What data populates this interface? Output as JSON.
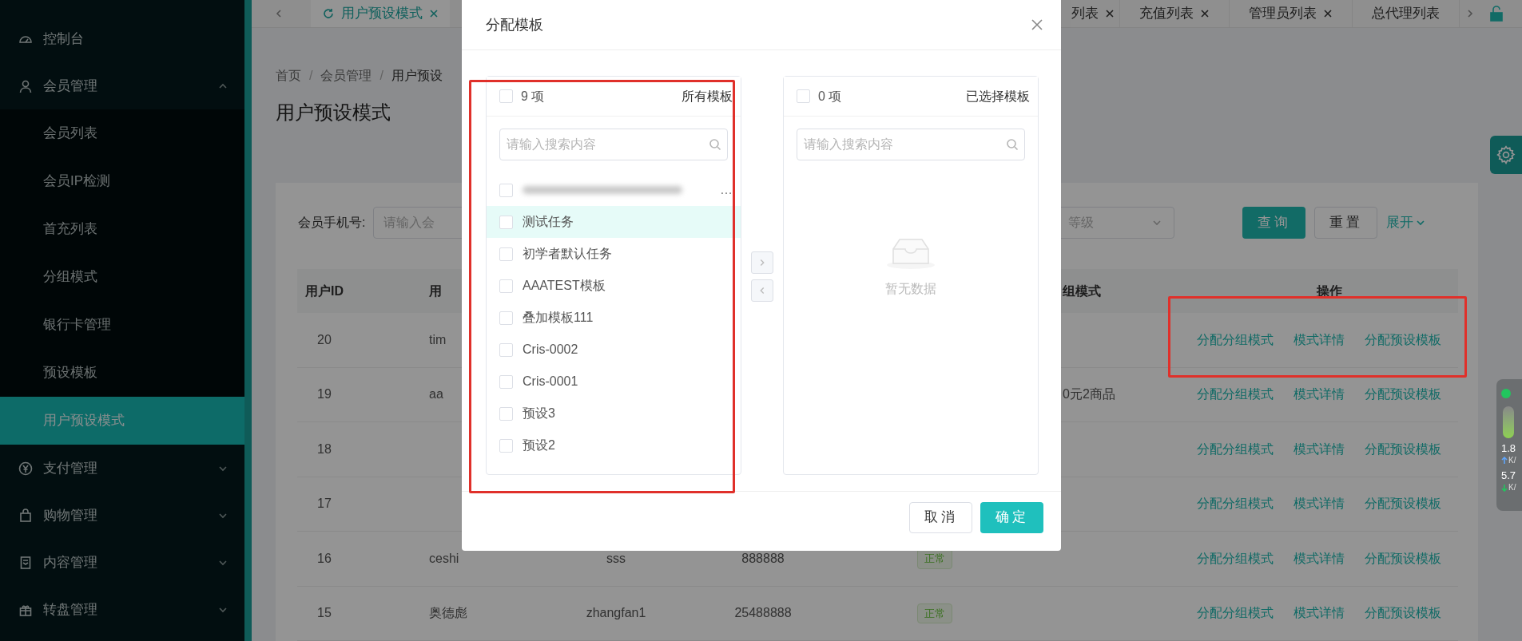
{
  "sidebar": {
    "items": [
      {
        "label": "控制台",
        "kind": "link",
        "selected": false
      },
      {
        "label": "会员管理",
        "kind": "group",
        "expanded": true,
        "children": [
          {
            "label": "会员列表",
            "selected": false
          },
          {
            "label": "会员IP检测",
            "selected": false
          },
          {
            "label": "首充列表",
            "selected": false
          },
          {
            "label": "分组模式",
            "selected": false
          },
          {
            "label": "银行卡管理",
            "selected": false
          },
          {
            "label": "预设模板",
            "selected": false
          },
          {
            "label": "用户预设模式",
            "selected": true
          }
        ]
      },
      {
        "label": "支付管理",
        "kind": "group",
        "expanded": false
      },
      {
        "label": "购物管理",
        "kind": "group",
        "expanded": false
      },
      {
        "label": "内容管理",
        "kind": "group",
        "expanded": false
      },
      {
        "label": "转盘管理",
        "kind": "group",
        "expanded": false
      }
    ]
  },
  "tabs": [
    {
      "label": "用户预设模式",
      "selected": true,
      "closable": true
    },
    {
      "label": "列表",
      "selected": false,
      "closable": true
    },
    {
      "label": "充值列表",
      "selected": false,
      "closable": true
    },
    {
      "label": "管理员列表",
      "selected": false,
      "closable": true
    },
    {
      "label": "总代理列表",
      "selected": false,
      "closable": false
    }
  ],
  "breadcrumb": {
    "items": [
      "首页",
      "会员管理",
      "用户预设"
    ],
    "separator": "/"
  },
  "page_title": "用户预设模式",
  "filters": {
    "phone_field": {
      "label": "会员手机号:",
      "placeholder": "请输入会"
    },
    "level_select": {
      "placeholder": "等级"
    },
    "buttons": [
      {
        "label": "查询",
        "kind": "primary"
      },
      {
        "label": "重置",
        "kind": "default"
      }
    ],
    "expand_link": "展开"
  },
  "table": {
    "columns": [
      {
        "header": "用户ID"
      },
      {
        "header": "用"
      },
      {},
      {},
      {},
      {
        "header": "组模式"
      },
      {
        "header": "操作"
      }
    ],
    "rows": [
      {
        "cells": [
          "20",
          "tim"
        ],
        "actions": [
          "分配分组模式",
          "模式详情",
          "分配预设模板"
        ]
      },
      {
        "cells": [
          "19",
          "aa",
          null,
          null,
          null,
          "0元2商品"
        ],
        "actions": [
          "分配分组模式",
          "模式详情",
          "分配预设模板"
        ]
      },
      {
        "cells": [
          "18"
        ],
        "actions": [
          "分配分组模式",
          "模式详情",
          "分配预设模板"
        ]
      },
      {
        "cells": [
          "17"
        ],
        "actions": [
          "分配分组模式",
          "模式详情",
          "分配预设模板"
        ]
      },
      {
        "cells": [
          "16",
          "ceshi",
          "sss",
          "888888",
          "正常"
        ],
        "actions": [
          "分配分组模式",
          "模式详情",
          "分配预设模板"
        ]
      },
      {
        "cells": [
          "15",
          "奥德彪",
          "zhangfan1",
          "25488888",
          "正常"
        ],
        "actions": [
          "分配分组模式",
          "模式详情",
          "分配预设模板"
        ]
      }
    ]
  },
  "dialog": {
    "title": "分配模板",
    "source": {
      "count": "9 项",
      "title": "所有模板",
      "checked": false,
      "placeholder": "请输入搜索内容",
      "items": [
        {
          "label": "…",
          "kind": "blurred",
          "checked": false,
          "hovered": false
        },
        {
          "label": "测试任务",
          "kind": "text",
          "checked": false,
          "hovered": true
        },
        {
          "label": "初学者默认任务",
          "kind": "text",
          "checked": false,
          "hovered": false
        },
        {
          "label": "AAATEST模板",
          "kind": "text",
          "checked": false,
          "hovered": false
        },
        {
          "label": "叠加模板111",
          "kind": "text",
          "checked": false,
          "hovered": false
        },
        {
          "label": "Cris-0002",
          "kind": "text",
          "checked": false,
          "hovered": false
        },
        {
          "label": "Cris-0001",
          "kind": "text",
          "checked": false,
          "hovered": false
        },
        {
          "label": "预设3",
          "kind": "text",
          "checked": false,
          "hovered": false
        },
        {
          "label": "预设2",
          "kind": "text",
          "checked": false,
          "hovered": false
        }
      ]
    },
    "target": {
      "count": "0 项",
      "title": "已选择模板",
      "checked": false,
      "placeholder": "请输入搜索内容",
      "empty_text": "暂无数据"
    },
    "buttons": [
      {
        "label": "取消",
        "kind": "default"
      },
      {
        "label": "确定",
        "kind": "primary"
      }
    ]
  },
  "net_widget": {
    "readings": [
      {
        "value": "1.8",
        "unit": "K/"
      },
      {
        "value": "5.7",
        "unit": "K/"
      }
    ]
  }
}
